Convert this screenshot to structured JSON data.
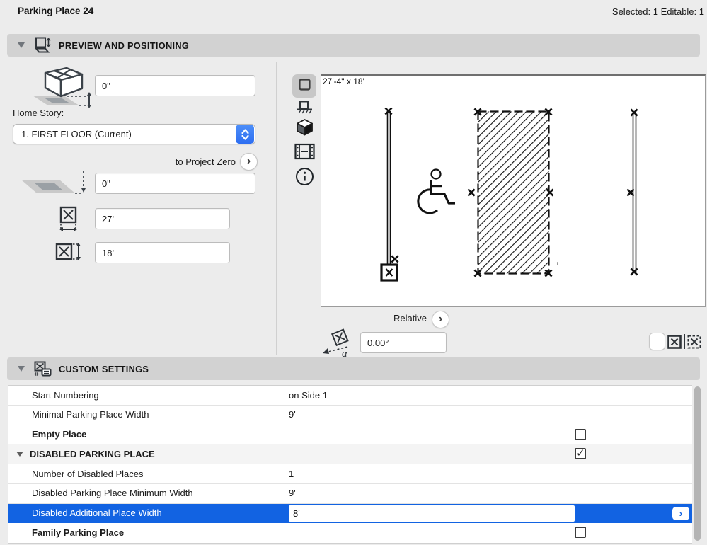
{
  "window": {
    "title": "Parking Place 24",
    "selection_status": "Selected: 1 Editable: 1"
  },
  "icons": {
    "checkmark": "✓",
    "chevron_right": "›"
  },
  "preview_positioning": {
    "section_title": "PREVIEW AND POSITIONING",
    "elevation_top": "0\"",
    "home_story_label": "Home Story:",
    "home_story_value": "1. FIRST FLOOR (Current)",
    "to_project_zero": "to Project Zero",
    "elevation_bottom": "0\"",
    "width": "27'",
    "height": "18'",
    "preview_dimension": "27'-4\" x 18'",
    "place_number": "1",
    "relative_label": "Relative",
    "rotation_angle": "0.00°"
  },
  "custom_settings": {
    "section_title": "CUSTOM SETTINGS",
    "rows": [
      {
        "label": "Start Numbering",
        "value": "on Side 1"
      },
      {
        "label": "Minimal Parking Place Width",
        "value": "9'"
      },
      {
        "label": "Empty Place",
        "checkbox": false
      },
      {
        "label": "DISABLED PARKING PLACE",
        "checkbox": true,
        "group": true
      },
      {
        "label": "Number of Disabled Places",
        "value": "1"
      },
      {
        "label": "Disabled Parking Place Minimum Width",
        "value": "9'"
      },
      {
        "label": "Disabled Additional Place Width",
        "value": "8'",
        "selected": true
      },
      {
        "label": "Family Parking Place",
        "checkbox": false
      }
    ]
  },
  "colors": {
    "selection_blue": "#1263e2",
    "stepper_blue": "#3478f6",
    "section_bar": "#d2d2d2",
    "window_bg": "#ececec"
  }
}
